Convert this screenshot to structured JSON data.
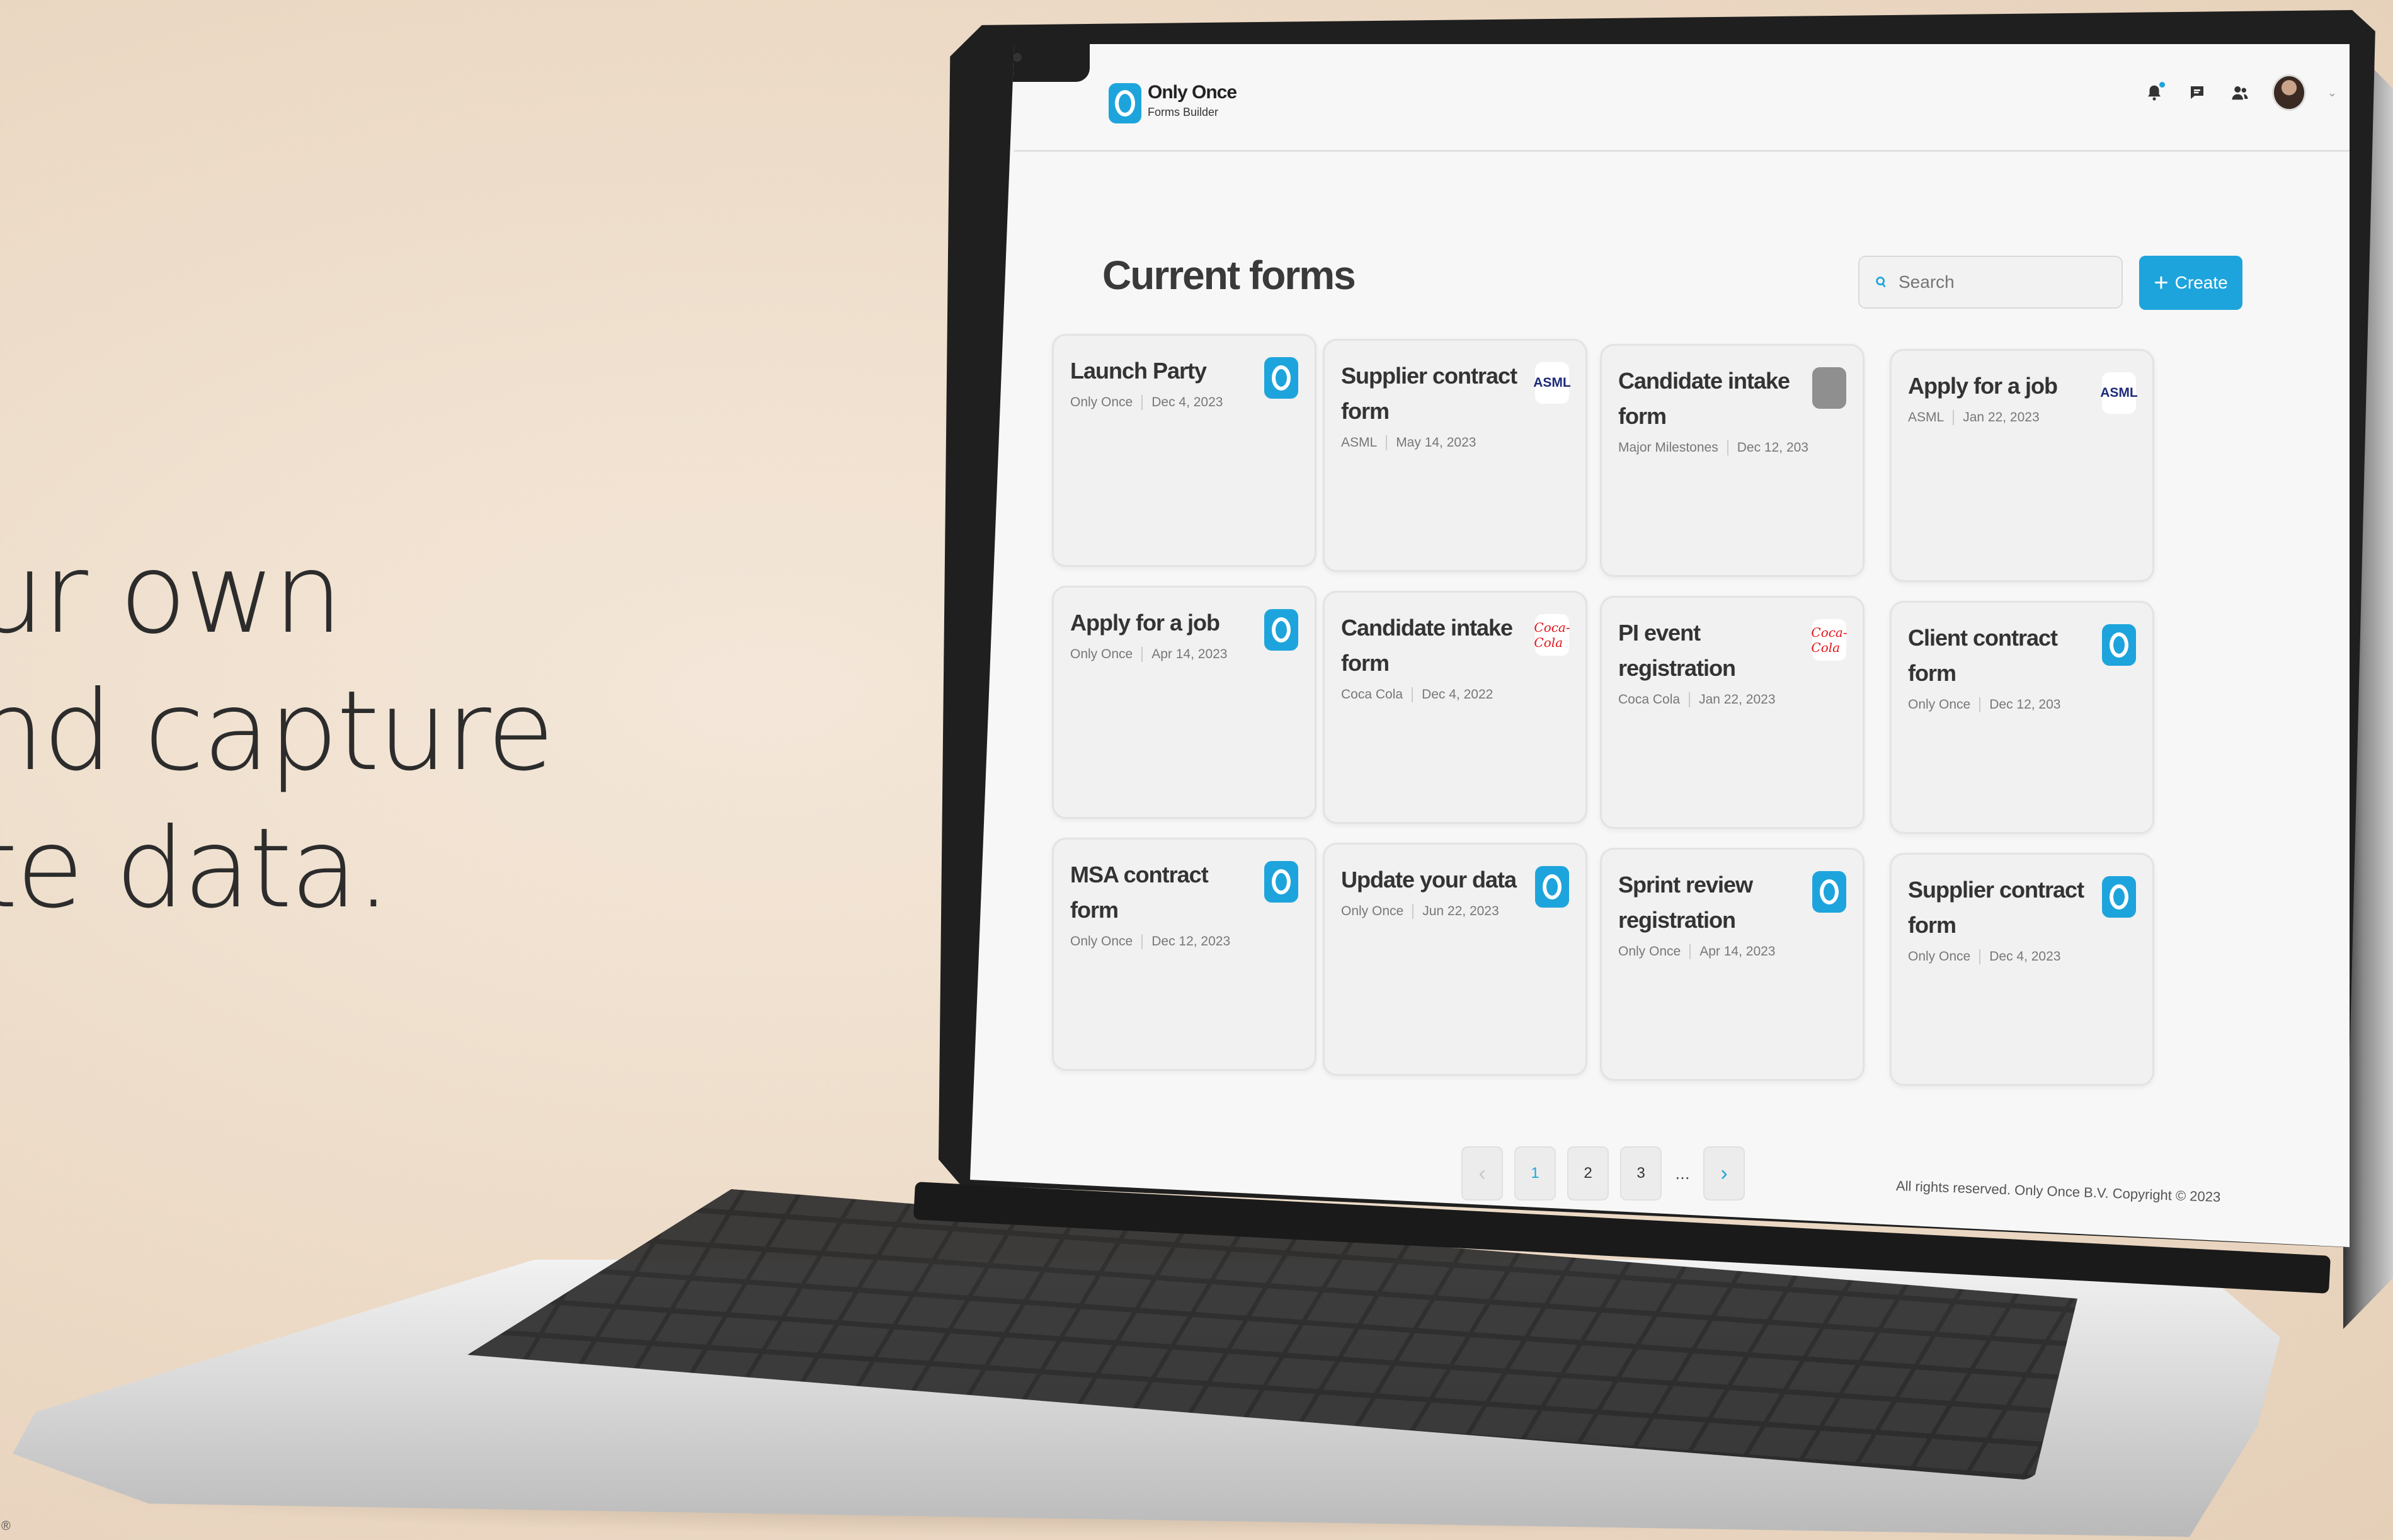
{
  "tagline": [
    "ur own",
    "nd capture",
    "te data."
  ],
  "registered_mark": "®",
  "app": {
    "brand_name": "Only Once",
    "brand_sub": "Forms Builder",
    "icons": [
      "bell-icon",
      "chat-icon",
      "users-icon",
      "avatar"
    ]
  },
  "page": {
    "title": "Current forms",
    "search_placeholder": "Search",
    "create_label": "Create"
  },
  "forms": [
    {
      "title": "Launch Party",
      "org": "Only Once",
      "date": "Dec 4, 2023",
      "logo": "onlyonce"
    },
    {
      "title": "Supplier contract form",
      "org": "ASML",
      "date": "May 14, 2023",
      "logo": "asml"
    },
    {
      "title": "Candidate intake form",
      "org": "Major Milestones",
      "date": "Dec 12, 203",
      "logo": "majormilestones"
    },
    {
      "title": "Apply for a job",
      "org": "ASML",
      "date": "Jan 22, 2023",
      "logo": "asml"
    },
    {
      "title": "Apply for a job",
      "org": "Only Once",
      "date": "Apr 14, 2023",
      "logo": "onlyonce"
    },
    {
      "title": "Candidate intake form",
      "org": "Coca Cola",
      "date": "Dec 4, 2022",
      "logo": "cocacola"
    },
    {
      "title": "PI event registration",
      "org": "Coca Cola",
      "date": "Jan 22, 2023",
      "logo": "cocacola"
    },
    {
      "title": "Client contract form",
      "org": "Only Once",
      "date": "Dec 12, 203",
      "logo": "onlyonce"
    },
    {
      "title": "MSA contract form",
      "org": "Only Once",
      "date": "Dec 12, 2023",
      "logo": "onlyonce"
    },
    {
      "title": "Update your data",
      "org": "Only Once",
      "date": "Jun 22, 2023",
      "logo": "onlyonce"
    },
    {
      "title": "Sprint review registration",
      "org": "Only Once",
      "date": "Apr 14, 2023",
      "logo": "onlyonce"
    },
    {
      "title": "Supplier contract form",
      "org": "Only Once",
      "date": "Dec 4, 2023",
      "logo": "onlyonce"
    }
  ],
  "logo_text": {
    "asml": "ASML",
    "cocacola": "Coca-Cola"
  },
  "pagination": {
    "pages": [
      "1",
      "2",
      "3"
    ],
    "current": "1",
    "ellipsis": "..."
  },
  "footer": "All rights reserved. Only Once B.V. Copyright © 2023",
  "colors": {
    "accent": "#1ea4dc",
    "background": "#efe1d0"
  }
}
